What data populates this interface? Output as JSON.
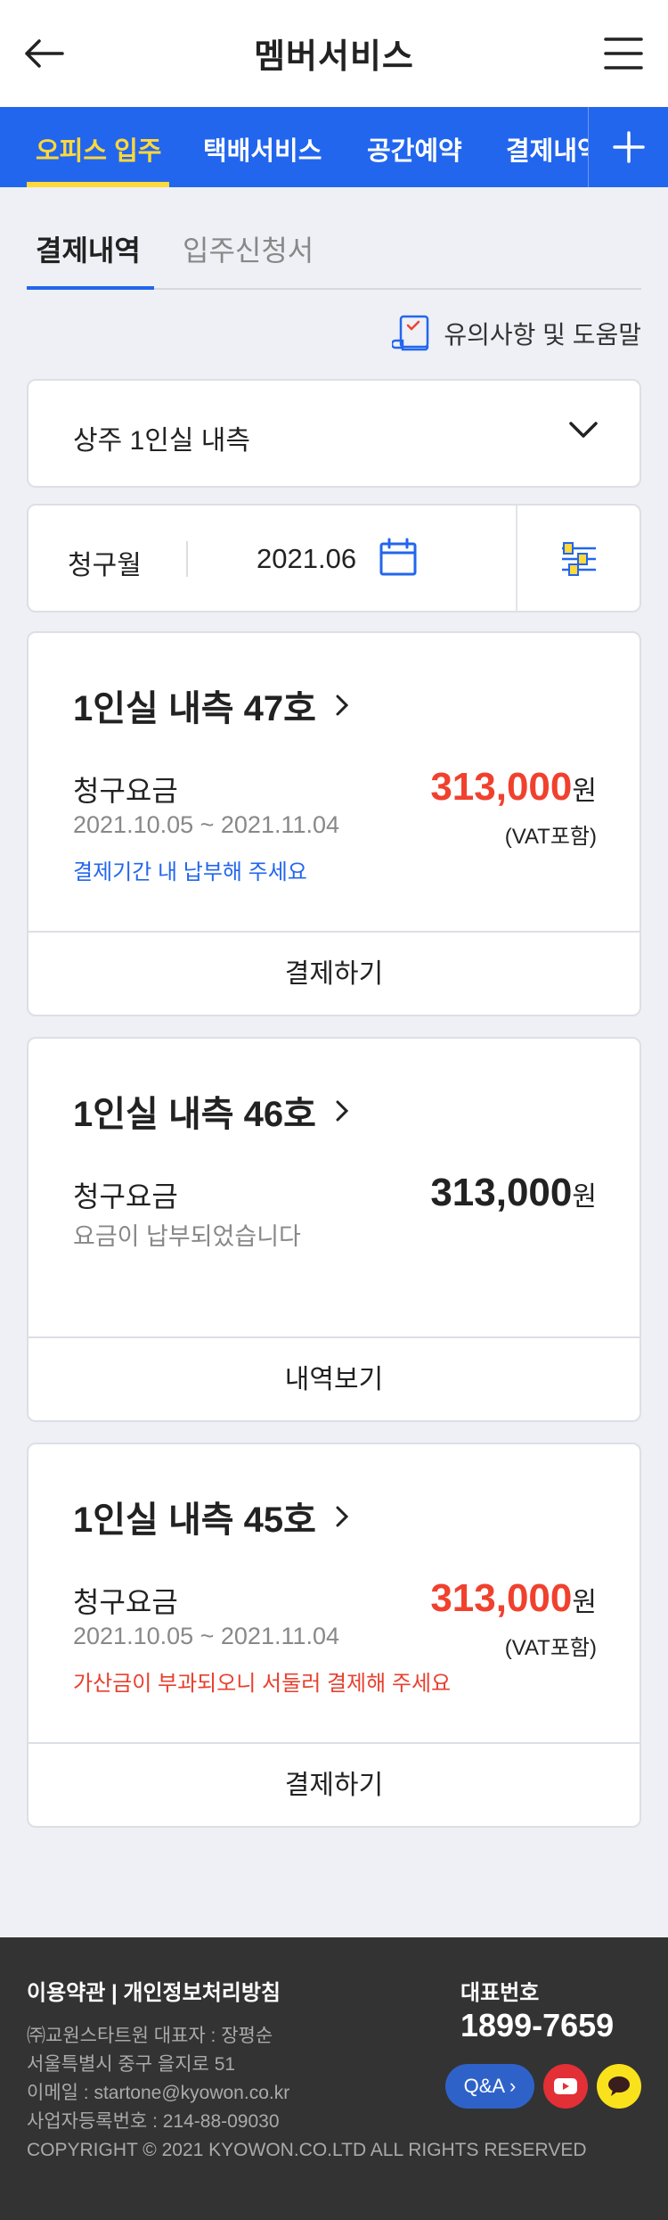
{
  "header": {
    "title": "멤버서비스",
    "back_icon": "arrow-left-icon",
    "menu_icon": "hamburger-menu-icon"
  },
  "main_tabs": [
    {
      "label": "오피스 입주",
      "active": true
    },
    {
      "label": "택배서비스",
      "active": false
    },
    {
      "label": "공간예약",
      "active": false
    },
    {
      "label": "결제내역",
      "active": false
    }
  ],
  "sub_tabs": [
    {
      "label": "결제내역",
      "active": true
    },
    {
      "label": "입주신청서",
      "active": false
    }
  ],
  "help": {
    "label": "유의사항 및 도움말"
  },
  "office_select": {
    "value": "상주 1인실 내측"
  },
  "billing_month": {
    "label": "청구월",
    "value": "2021.06"
  },
  "bills": [
    {
      "name": "1인실 내측 47호",
      "charge_label": "청구요금",
      "period": "2021.10.05 ~ 2021.11.04",
      "notice": "결제기간 내 납부해 주세요",
      "amount": "313,000",
      "currency": "원",
      "vat": "(VAT포함)",
      "action": "결제하기"
    },
    {
      "name": "1인실 내측 46호",
      "charge_label": "청구요금",
      "period": "요금이 납부되었습니다",
      "notice": "",
      "amount": "313,000",
      "currency": "원",
      "vat": "",
      "action": "내역보기"
    },
    {
      "name": "1인실 내측 45호",
      "charge_label": "청구요금",
      "period": "2021.10.05 ~ 2021.11.04",
      "notice": "가산금이 부과되오니 서둘러 결제해 주세요",
      "amount": "313,000",
      "currency": "원",
      "vat": "(VAT포함)",
      "action": "결제하기"
    }
  ],
  "footer": {
    "links": "이용약관 | 개인정보처리방침",
    "company": "㈜교원스타트원 대표자 : 장평순",
    "address": "서울특별시 중구 을지로 51",
    "email": "이메일 : startone@kyowon.co.kr",
    "business_no": "사업자등록번호 : 214-88-09030",
    "copyright": "COPYRIGHT © 2021 KYOWON.CO.LTD ALL RIGHTS RESERVED",
    "rep_label": "대표번호",
    "phone": "1899-7659",
    "qa_label": "Q&A"
  },
  "colors": {
    "brand_blue": "#2266ee",
    "active_tab": "#ffd83a",
    "amount_red": "#f0412e",
    "footer_bg": "#333333"
  }
}
